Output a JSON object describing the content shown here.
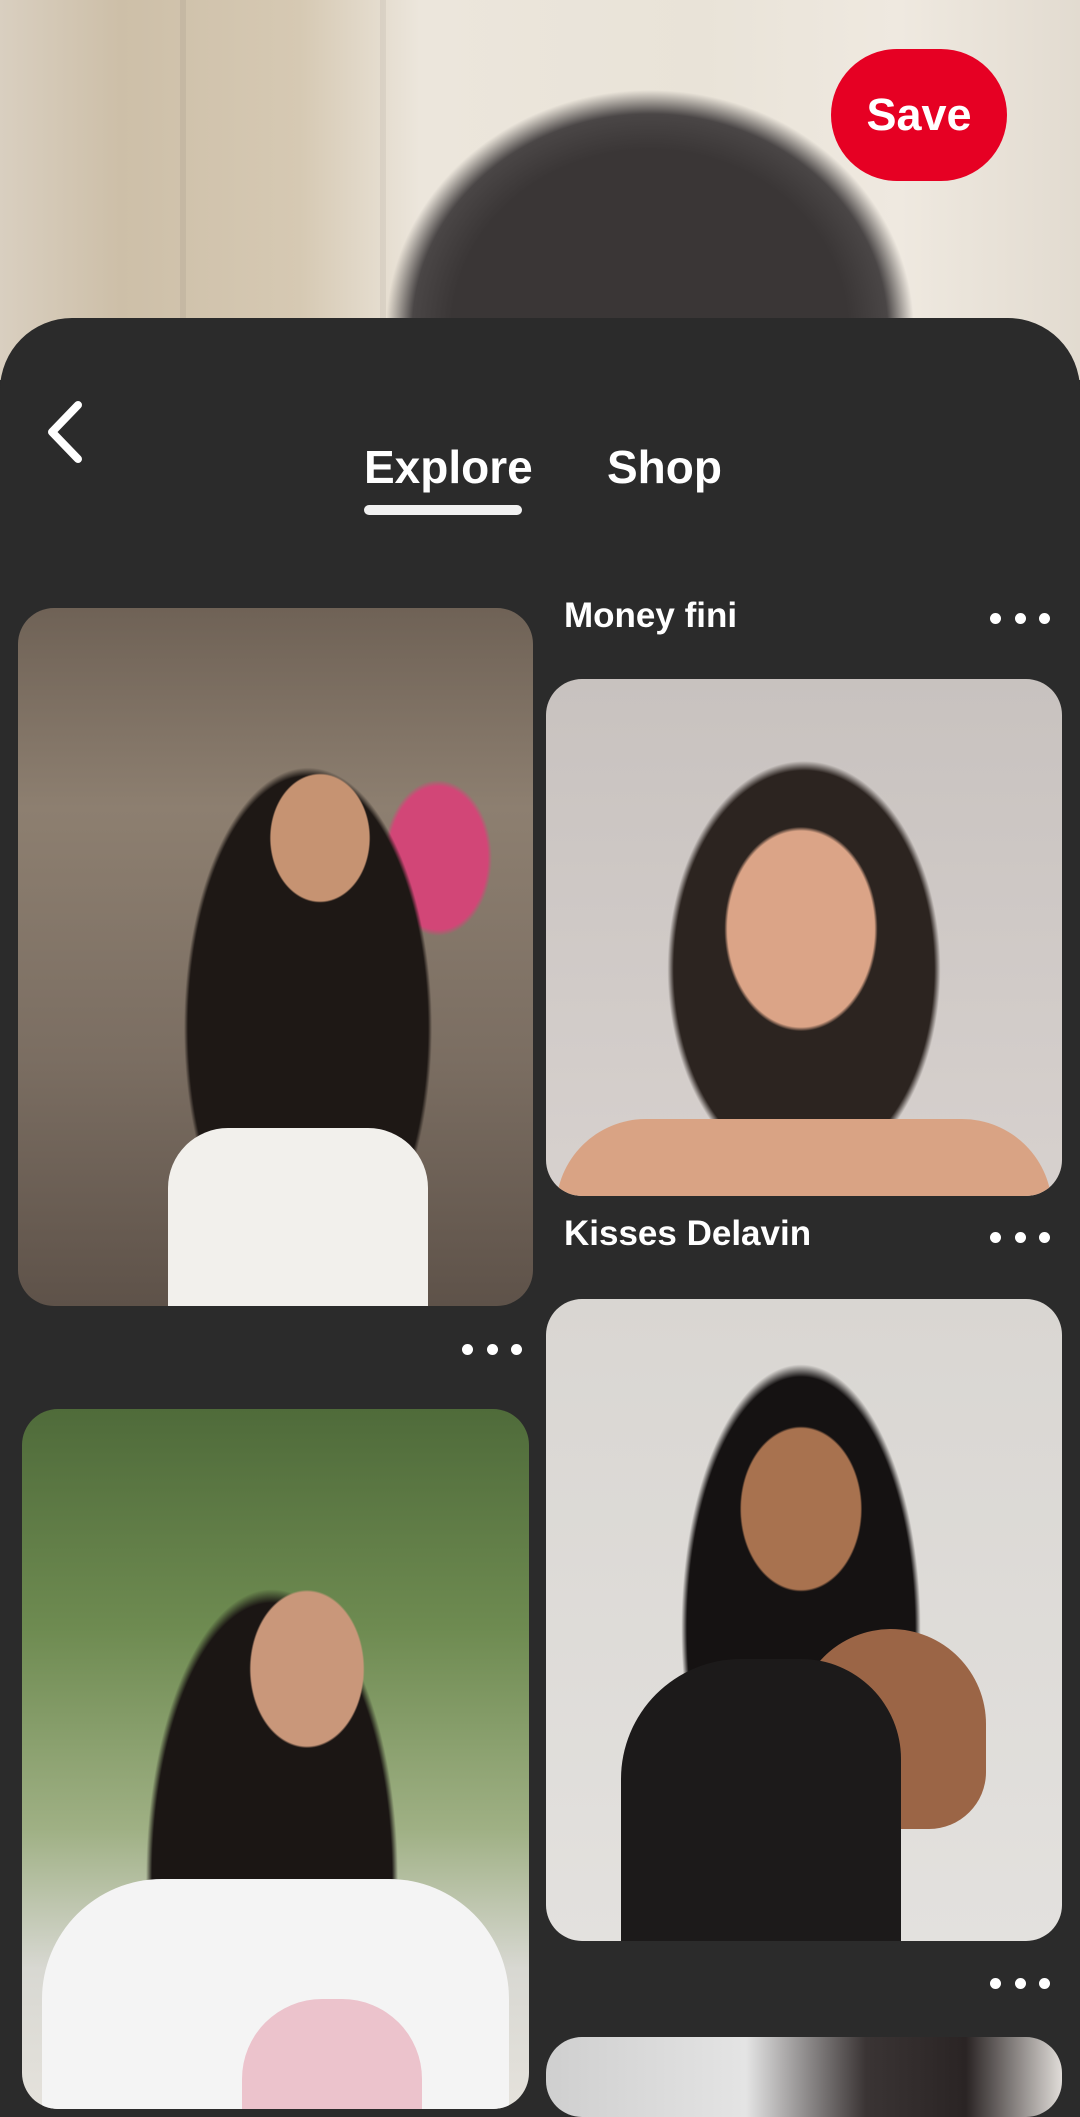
{
  "header": {
    "save_label": "Save"
  },
  "tabs": [
    {
      "label": "Explore",
      "selected": true
    },
    {
      "label": "Shop",
      "selected": false
    }
  ],
  "pins": [
    {
      "column": "left",
      "title": ""
    },
    {
      "column": "right",
      "title": "Money fini"
    },
    {
      "column": "right",
      "title": "Kisses Delavin"
    },
    {
      "column": "left",
      "title": ""
    },
    {
      "column": "right",
      "title": ""
    }
  ],
  "icons": {
    "back": "chevron-left-icon",
    "more": "more-horizontal-icon"
  },
  "colors": {
    "save_button": "#e60023",
    "background": "#2b2b2b",
    "text": "#ffffff"
  }
}
